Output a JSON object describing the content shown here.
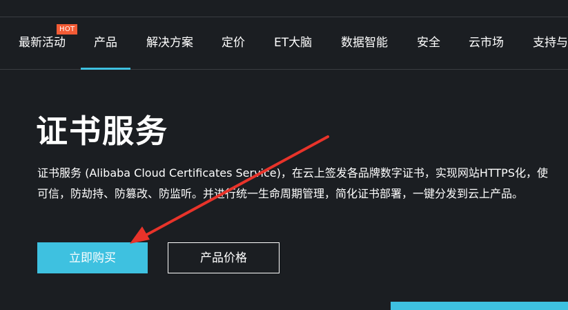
{
  "nav": {
    "items": [
      {
        "label": "最新活动"
      },
      {
        "label": "产品"
      },
      {
        "label": "解决方案"
      },
      {
        "label": "定价"
      },
      {
        "label": "ET大脑"
      },
      {
        "label": "数据智能"
      },
      {
        "label": "安全"
      },
      {
        "label": "云市场"
      },
      {
        "label": "支持与"
      }
    ],
    "badge": "HOT",
    "active_index": 1
  },
  "hero": {
    "title": "证书服务",
    "description_line1": "证书服务 (Alibaba Cloud Certificates Service)，在云上签发各品牌数字证书，实现网站HTTPS化，使",
    "description_line2": "可信，防劫持、防篡改、防监听。并进行统一生命周期管理，简化证书部署，一键分发到云上产品。"
  },
  "buttons": {
    "buy_label": "立即购买",
    "price_label": "产品价格"
  },
  "colors": {
    "background": "#1b1e22",
    "accent": "#3ec1e0",
    "badge": "#f35b35",
    "annotation": "#e8332a"
  }
}
